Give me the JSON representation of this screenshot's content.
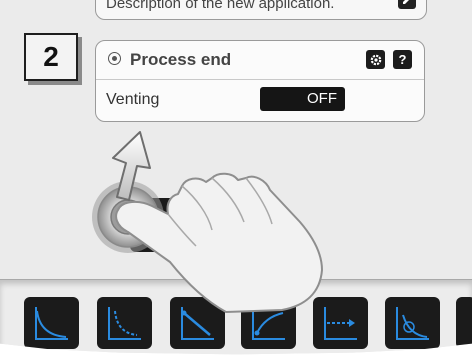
{
  "step": {
    "number": "2"
  },
  "top_card": {
    "description": "Description of the new application."
  },
  "process_card": {
    "title": "Process end",
    "settings_icon": "gear-icon",
    "help_label": "?",
    "radio_icon": "radio-icon"
  },
  "venting": {
    "label": "Venting",
    "value": "OFF"
  },
  "dock": {
    "tiles": [
      {
        "icon": "exponential-curve-icon"
      },
      {
        "icon": "dashed-decay-curve-icon"
      },
      {
        "icon": "linear-decrease-icon"
      },
      {
        "icon": "rise-curve-icon"
      },
      {
        "icon": "arrow-line-icon"
      },
      {
        "icon": "target-curve-icon"
      }
    ]
  },
  "gesture": {
    "icons": [
      "tap-hand-icon",
      "swipe-up-arrow-icon",
      "touch-ripple-icon"
    ]
  },
  "colors": {
    "accent_blue": "#1a7fd6",
    "tile_bg": "#1b1b1b",
    "toggle_bg": "#151515"
  }
}
